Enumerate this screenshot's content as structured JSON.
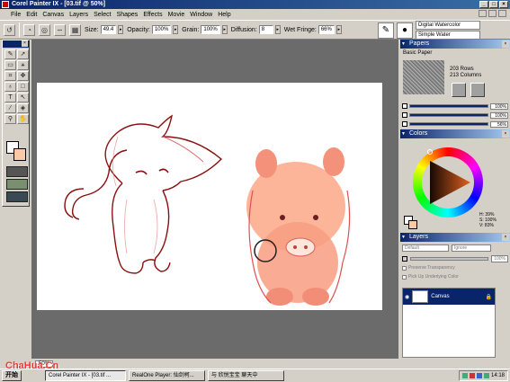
{
  "window": {
    "title": "Corel Painter IX - [03.tif @ 50%]"
  },
  "menu": [
    "File",
    "Edit",
    "Canvas",
    "Layers",
    "Select",
    "Shapes",
    "Effects",
    "Movie",
    "Window",
    "Help"
  ],
  "toolbar": {
    "size_label": "Size:",
    "size_value": "49.4",
    "opacity_label": "Opacity:",
    "opacity_value": "100%",
    "grain_label": "Grain:",
    "grain_value": "100%",
    "diffusion_label": "Diffusion:",
    "diffusion_value": "8",
    "wetfringe_label": "Wet Fringe:",
    "wetfringe_value": "66%",
    "brush_category": "Digital Watercolor",
    "brush_variant": "Simple Water"
  },
  "papers": {
    "title": "Papers",
    "name": "Basic Paper",
    "rows": "203 Rows",
    "cols": "213 Columns",
    "scale": "100%",
    "contrast": "100%",
    "brightness": "56%"
  },
  "colors": {
    "title": "Colors",
    "h": "H: 39%",
    "s": "S: 100%",
    "v": "V: 83%"
  },
  "layers": {
    "title": "Layers",
    "composite_method": "Default",
    "composite_depth": "Ignore",
    "opacity": "100%",
    "preserve": "Preserve Transparency",
    "pickup": "Pick Up Underlying Color",
    "items": [
      {
        "name": "Canvas"
      }
    ]
  },
  "status": {
    "zoom": "50%"
  },
  "taskbar": {
    "start": "开始",
    "tasks": [
      "Corel Painter IX - [03.tif ...",
      "RealOne Player: 仙剑柯...",
      "与 欣悦宝宝 聊天中"
    ],
    "clock": "14:18"
  },
  "watermark": "ChaHua.Cn",
  "accent": "#0a246a"
}
